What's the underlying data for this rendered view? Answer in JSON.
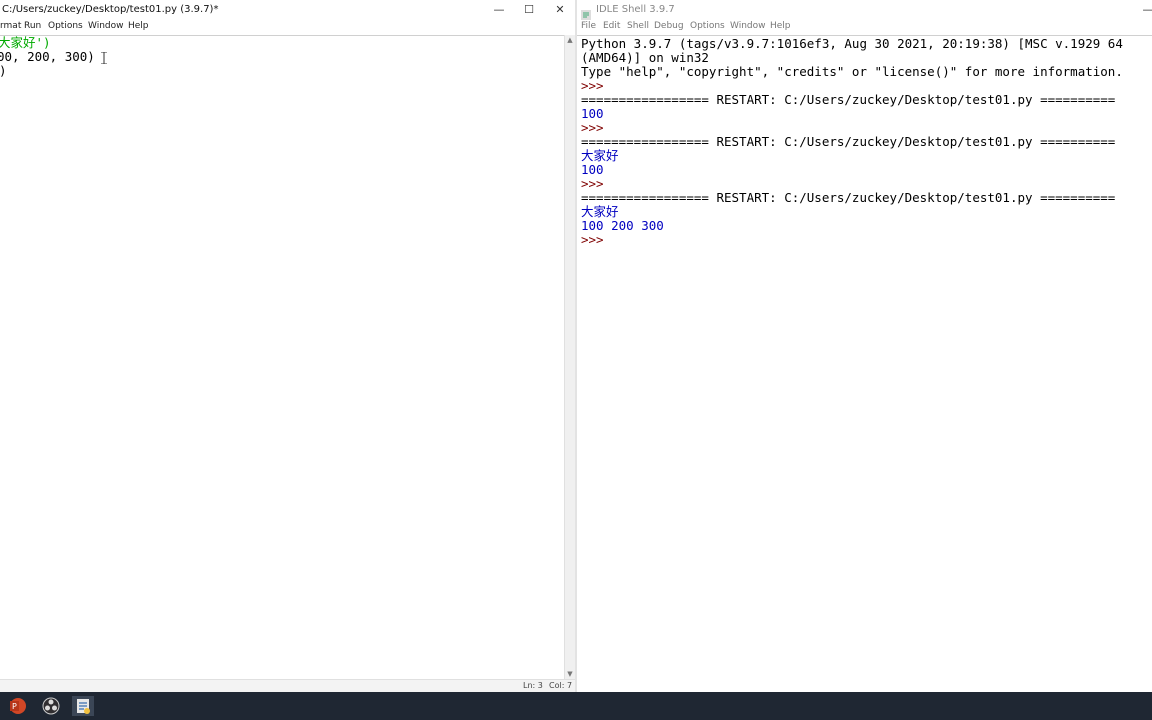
{
  "editor": {
    "title": "C:/Users/zuckey/Desktop/test01.py (3.9.7)*",
    "controls": {
      "minimize": "—",
      "maximize": "☐",
      "close": "✕"
    },
    "menu": [
      "rmat",
      "Run",
      "Options",
      "Window",
      "Help"
    ],
    "lines": [
      "大家好')",
      "00, 200, 300)",
      ")"
    ],
    "status": {
      "line": "Ln: 3",
      "col": "Col: 7"
    }
  },
  "shell": {
    "title": "IDLE Shell 3.9.7",
    "menu": [
      "File",
      "Edit",
      "Shell",
      "Debug",
      "Options",
      "Window",
      "Help"
    ],
    "lines": [
      "Python 3.9.7 (tags/v3.9.7:1016ef3, Aug 30 2021, 20:19:38) [MSC v.1929 64",
      "(AMD64)] on win32",
      "Type \"help\", \"copyright\", \"credits\" or \"license()\" for more information.",
      ">>> ",
      "================= RESTART: C:/Users/zuckey/Desktop/test01.py ==========",
      "100",
      ">>> ",
      "================= RESTART: C:/Users/zuckey/Desktop/test01.py ==========",
      "大家好",
      "100",
      ">>> ",
      "================= RESTART: C:/Users/zuckey/Desktop/test01.py ==========",
      "大家好",
      "100 200 300",
      ">>> "
    ]
  },
  "taskbar": {
    "icons": [
      "powerpoint-icon",
      "obs-icon",
      "idle-icon"
    ]
  }
}
